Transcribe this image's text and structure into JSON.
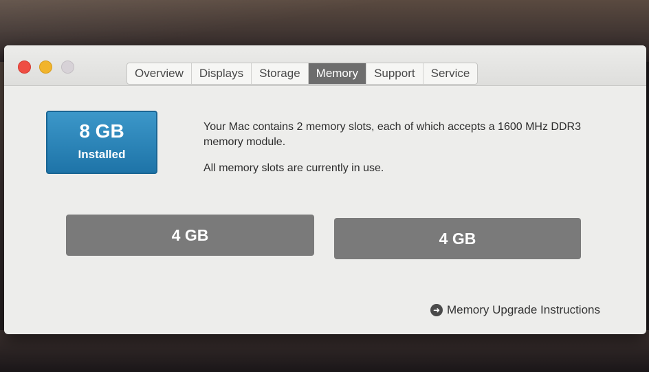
{
  "tabs": {
    "overview": "Overview",
    "displays": "Displays",
    "storage": "Storage",
    "memory": "Memory",
    "support": "Support",
    "service": "Service",
    "active": "Memory"
  },
  "summary": {
    "total": "8 GB",
    "label": "Installed"
  },
  "description": {
    "line1": "Your Mac contains 2 memory slots, each of which accepts a 1600 MHz DDR3 memory module.",
    "line2": "All memory slots are currently in use."
  },
  "slots": [
    {
      "size": "4 GB"
    },
    {
      "size": "4 GB"
    }
  ],
  "link": {
    "label": "Memory Upgrade Instructions",
    "icon": "arrow-circle-icon"
  },
  "colors": {
    "accent": "#2a84b8",
    "slot": "#7a7a7a",
    "active_tab": "#6d6d6d"
  }
}
